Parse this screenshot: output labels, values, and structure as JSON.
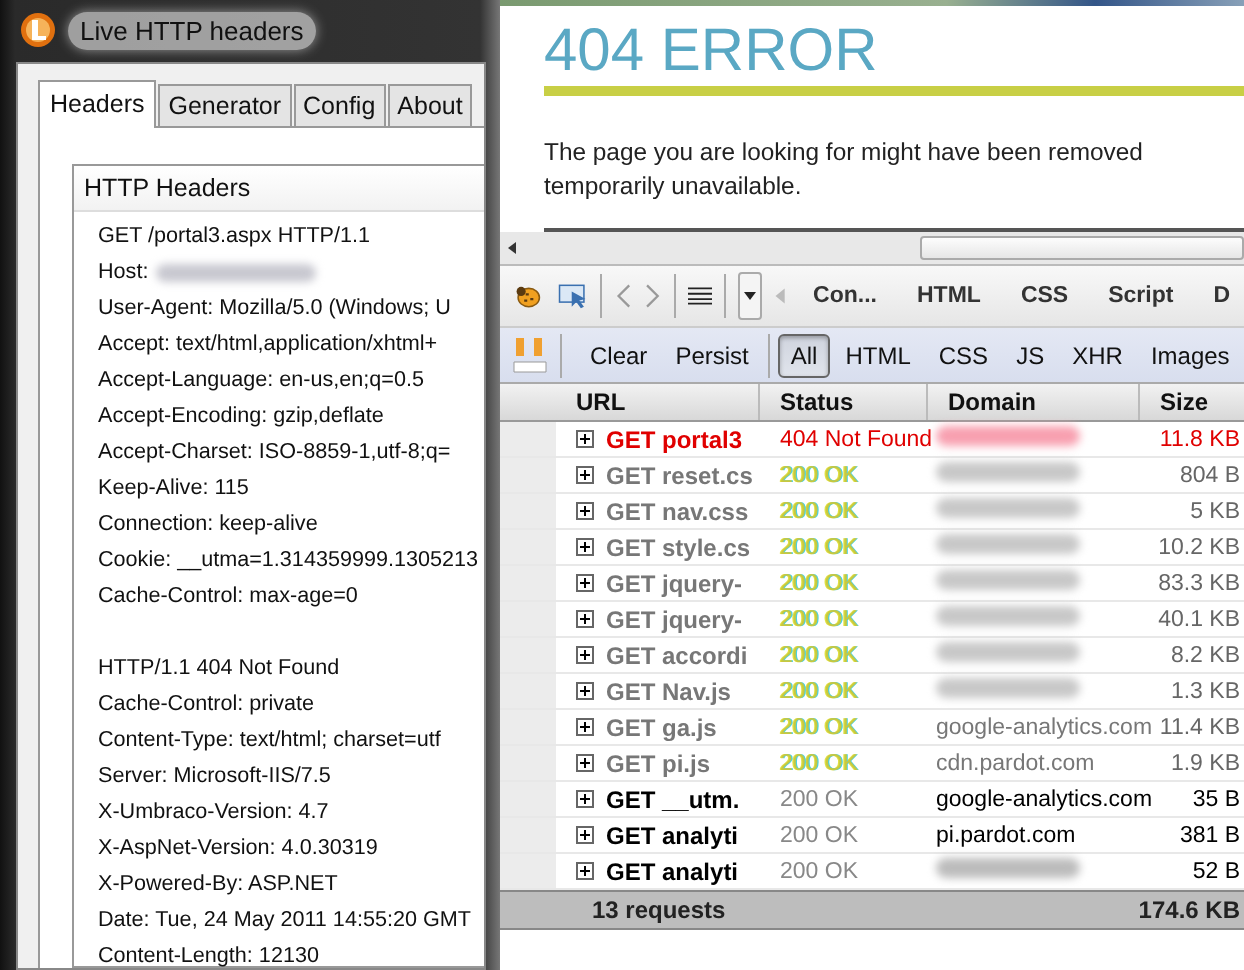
{
  "headers_window": {
    "title": "Live HTTP headers",
    "tabs": [
      {
        "label": "Headers",
        "selected": true
      },
      {
        "label": "Generator",
        "selected": false
      },
      {
        "label": "Config",
        "selected": false
      },
      {
        "label": "About",
        "selected": false
      }
    ],
    "list_title": "HTTP Headers",
    "lines": [
      {
        "text": "GET /portal3.aspx HTTP/1.1"
      },
      {
        "text": "Host:",
        "value_redacted": true
      },
      {
        "text": "User-Agent: Mozilla/5.0 (Windows; U"
      },
      {
        "text": "Accept: text/html,application/xhtml+"
      },
      {
        "text": "Accept-Language: en-us,en;q=0.5"
      },
      {
        "text": "Accept-Encoding: gzip,deflate"
      },
      {
        "text": "Accept-Charset: ISO-8859-1,utf-8;q="
      },
      {
        "text": "Keep-Alive: 115"
      },
      {
        "text": "Connection: keep-alive"
      },
      {
        "text": "Cookie: __utma=1.314359999.1305213"
      },
      {
        "text": "Cache-Control: max-age=0"
      },
      {
        "text": "HTTP/1.1 404 Not Found",
        "blank_before": true
      },
      {
        "text": "Cache-Control: private"
      },
      {
        "text": "Content-Type: text/html; charset=utf"
      },
      {
        "text": "Server: Microsoft-IIS/7.5"
      },
      {
        "text": "X-Umbraco-Version: 4.7"
      },
      {
        "text": "X-AspNet-Version: 4.0.30319"
      },
      {
        "text": "X-Powered-By: ASP.NET"
      },
      {
        "text": "Date: Tue, 24 May 2011 14:55:20 GMT"
      },
      {
        "text": "Content-Length: 12130"
      }
    ]
  },
  "browser": {
    "heading": "404 ERROR",
    "message_lines": [
      "The page you are looking for might have been removed",
      "temporarily unavailable."
    ],
    "firebug": {
      "panel_tabs": [
        "Con...",
        "HTML",
        "CSS",
        "Script",
        "D"
      ],
      "actions": [
        "Clear",
        "Persist"
      ],
      "filters": [
        {
          "label": "All",
          "selected": true
        },
        {
          "label": "HTML",
          "selected": false
        },
        {
          "label": "CSS",
          "selected": false
        },
        {
          "label": "JS",
          "selected": false
        },
        {
          "label": "XHR",
          "selected": false
        },
        {
          "label": "Images",
          "selected": false
        }
      ],
      "columns": [
        "URL",
        "Status",
        "Domain",
        "Size"
      ],
      "requests": [
        {
          "kind": "error",
          "url": "GET portal3",
          "status": "404 Not Found",
          "domain_redacted": true,
          "size": "11.8 KB"
        },
        {
          "kind": "cached",
          "url": "GET reset.cs",
          "status": "200 OK",
          "domain_redacted": true,
          "size": "804 B"
        },
        {
          "kind": "cached",
          "url": "GET nav.css",
          "status": "200 OK",
          "domain_redacted": true,
          "size": "5 KB"
        },
        {
          "kind": "cached",
          "url": "GET style.cs",
          "status": "200 OK",
          "domain_redacted": true,
          "size": "10.2 KB"
        },
        {
          "kind": "cached",
          "url": "GET jquery-",
          "status": "200 OK",
          "domain_redacted": true,
          "size": "83.3 KB"
        },
        {
          "kind": "cached",
          "url": "GET jquery-",
          "status": "200 OK",
          "domain_redacted": true,
          "size": "40.1 KB"
        },
        {
          "kind": "cached",
          "url": "GET accordi",
          "status": "200 OK",
          "domain_redacted": true,
          "size": "8.2 KB"
        },
        {
          "kind": "cached",
          "url": "GET Nav.js",
          "status": "200 OK",
          "domain_redacted": true,
          "size": "1.3 KB"
        },
        {
          "kind": "cached",
          "url": "GET ga.js",
          "status": "200 OK",
          "domain": "google-analytics.com",
          "size": "11.4 KB"
        },
        {
          "kind": "cached",
          "url": "GET pi.js",
          "status": "200 OK",
          "domain": "cdn.pardot.com",
          "size": "1.9 KB"
        },
        {
          "kind": "normal",
          "url": "GET __utm.",
          "status": "200 OK",
          "domain": "google-analytics.com",
          "size": "35 B"
        },
        {
          "kind": "normal",
          "url": "GET analyti",
          "status": "200 OK",
          "domain": "pi.pardot.com",
          "size": "381 B"
        },
        {
          "kind": "normal",
          "url": "GET analyti",
          "status": "200 OK",
          "domain_redacted": true,
          "size": "52 B"
        }
      ],
      "summary": {
        "count": "13 requests",
        "total": "174.6 KB"
      }
    }
  }
}
